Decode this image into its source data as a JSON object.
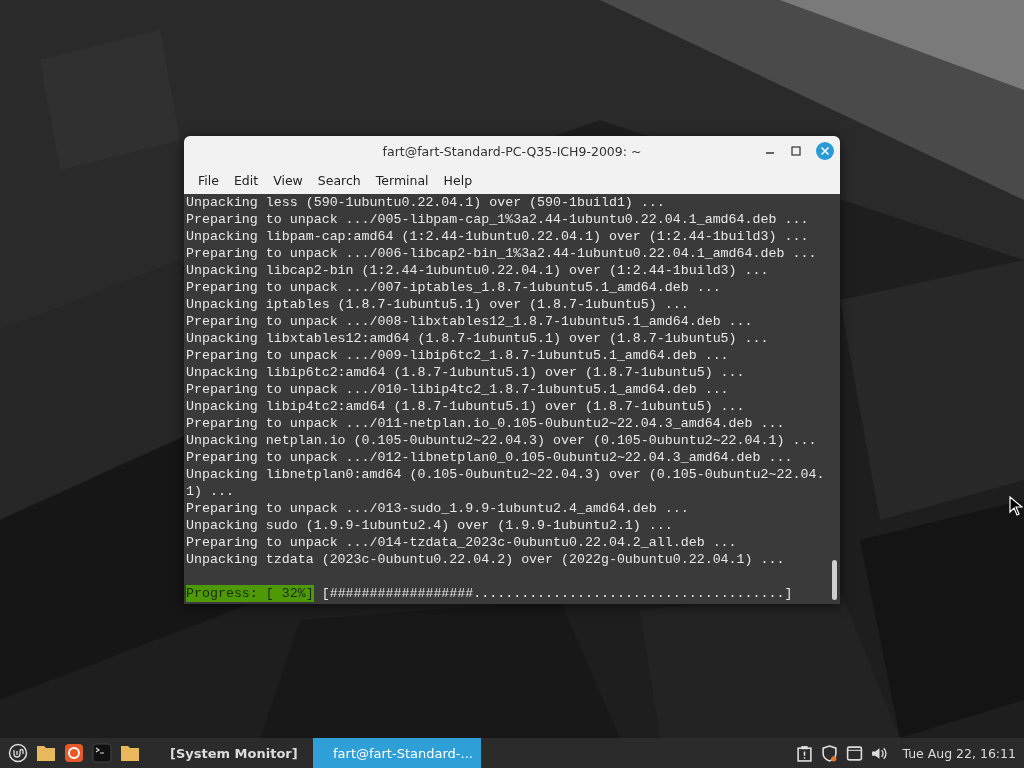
{
  "window": {
    "title": "fart@fart-Standard-PC-Q35-ICH9-2009: ~",
    "menu": [
      "File",
      "Edit",
      "View",
      "Search",
      "Terminal",
      "Help"
    ],
    "lines": [
      "Unpacking less (590-1ubuntu0.22.04.1) over (590-1build1) ...",
      "Preparing to unpack .../005-libpam-cap_1%3a2.44-1ubuntu0.22.04.1_amd64.deb ...",
      "Unpacking libpam-cap:amd64 (1:2.44-1ubuntu0.22.04.1) over (1:2.44-1build3) ...",
      "Preparing to unpack .../006-libcap2-bin_1%3a2.44-1ubuntu0.22.04.1_amd64.deb ...",
      "Unpacking libcap2-bin (1:2.44-1ubuntu0.22.04.1) over (1:2.44-1build3) ...",
      "Preparing to unpack .../007-iptables_1.8.7-1ubuntu5.1_amd64.deb ...",
      "Unpacking iptables (1.8.7-1ubuntu5.1) over (1.8.7-1ubuntu5) ...",
      "Preparing to unpack .../008-libxtables12_1.8.7-1ubuntu5.1_amd64.deb ...",
      "Unpacking libxtables12:amd64 (1.8.7-1ubuntu5.1) over (1.8.7-1ubuntu5) ...",
      "Preparing to unpack .../009-libip6tc2_1.8.7-1ubuntu5.1_amd64.deb ...",
      "Unpacking libip6tc2:amd64 (1.8.7-1ubuntu5.1) over (1.8.7-1ubuntu5) ...",
      "Preparing to unpack .../010-libip4tc2_1.8.7-1ubuntu5.1_amd64.deb ...",
      "Unpacking libip4tc2:amd64 (1.8.7-1ubuntu5.1) over (1.8.7-1ubuntu5) ...",
      "Preparing to unpack .../011-netplan.io_0.105-0ubuntu2~22.04.3_amd64.deb ...",
      "Unpacking netplan.io (0.105-0ubuntu2~22.04.3) over (0.105-0ubuntu2~22.04.1) ...",
      "Preparing to unpack .../012-libnetplan0_0.105-0ubuntu2~22.04.3_amd64.deb ...",
      "Unpacking libnetplan0:amd64 (0.105-0ubuntu2~22.04.3) over (0.105-0ubuntu2~22.04.",
      "1) ...",
      "Preparing to unpack .../013-sudo_1.9.9-1ubuntu2.4_amd64.deb ...",
      "Unpacking sudo (1.9.9-1ubuntu2.4) over (1.9.9-1ubuntu2.1) ...",
      "Preparing to unpack .../014-tzdata_2023c-0ubuntu0.22.04.2_all.deb ...",
      "Unpacking tzdata (2023c-0ubuntu0.22.04.2) over (2022g-0ubuntu0.22.04.1) ..."
    ],
    "progress": {
      "label": "Progress: [ 32%]",
      "bar": "[##################.......................................]"
    }
  },
  "taskbar": {
    "tasks": [
      {
        "label": "[System Monitor]",
        "selected": false,
        "kind": "monitor"
      },
      {
        "label": "fart@fart-Standard-...",
        "selected": true,
        "kind": "terminal"
      }
    ],
    "clock": "Tue Aug 22, 16:11"
  }
}
